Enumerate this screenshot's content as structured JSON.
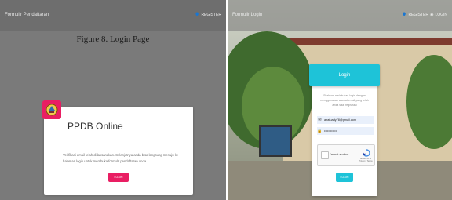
{
  "left_panel": {
    "title": "Formulir Pendaftaran",
    "register_label": "REGISTER",
    "caption": "Figure 8. Login Page",
    "card": {
      "title": "PPDB Online",
      "message": "Verifikasi email telah di laksanakan. Selanjutnya anda bisa langsung menuju ke halaman login untuk membuka formulir pendaftaran anda.",
      "button_label": "LOGIN"
    }
  },
  "right_panel": {
    "title": "Formulir Login",
    "register_label": "REGISTER",
    "login_label": "LOGIN",
    "card": {
      "header": "Login",
      "message": "Silahkan melakukan login dengan menggunakan alamat email yang telah anda saat registrasi",
      "email_value": "alrafuady78@gmail.com",
      "password_value": "••••••••••••",
      "captcha_text": "I'm not a robot",
      "captcha_brand": "reCAPTCHA",
      "captcha_links": "Privacy - Terms",
      "button_label": "LOGIN"
    }
  },
  "colors": {
    "accent_pink": "#e91e63",
    "accent_cyan": "#1ec3d8"
  }
}
